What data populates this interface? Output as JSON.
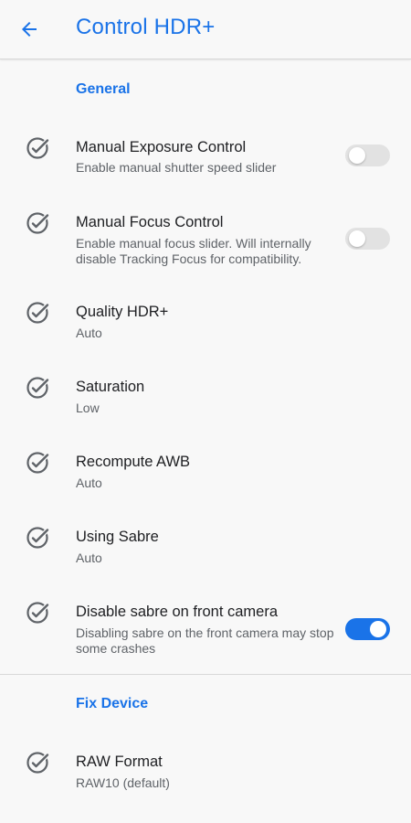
{
  "app_bar": {
    "title": "Control HDR+",
    "back_icon": "arrow-left-icon"
  },
  "colors": {
    "accent": "#1a73e8",
    "switch_off": "#e2e2e2",
    "text_primary": "#202124",
    "text_secondary": "#5f6368",
    "background": "#f8f8f8"
  },
  "sections": [
    {
      "header": "General",
      "items": [
        {
          "title": "Manual Exposure Control",
          "summary": "Enable manual shutter speed slider",
          "icon": "check-circle-icon",
          "switch": false
        },
        {
          "title": "Manual Focus Control",
          "summary": "Enable manual focus slider. Will internally disable Tracking Focus for compatibility.",
          "icon": "check-circle-icon",
          "switch": false
        },
        {
          "title": "Quality HDR+",
          "summary": "Auto",
          "icon": "check-circle-icon"
        },
        {
          "title": "Saturation",
          "summary": "Low",
          "icon": "check-circle-icon"
        },
        {
          "title": "Recompute AWB",
          "summary": "Auto",
          "icon": "check-circle-icon"
        },
        {
          "title": "Using Sabre",
          "summary": "Auto",
          "icon": "check-circle-icon"
        },
        {
          "title": "Disable sabre on front camera",
          "summary": "Disabling sabre on the front camera may stop some crashes",
          "icon": "check-circle-icon",
          "switch": true
        }
      ]
    },
    {
      "header": "Fix Device",
      "items": [
        {
          "title": "RAW Format",
          "summary": "RAW10 (default)",
          "icon": "check-circle-icon"
        }
      ]
    }
  ]
}
